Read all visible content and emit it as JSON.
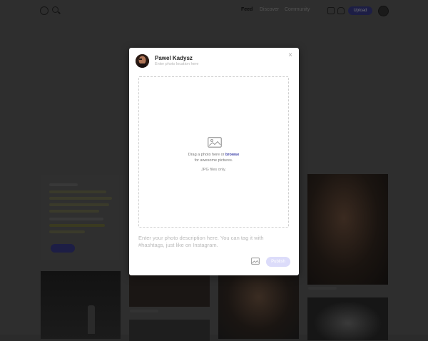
{
  "nav": {
    "items": [
      {
        "label": "Feed",
        "active": true
      },
      {
        "label": "Discover",
        "active": false
      },
      {
        "label": "Community",
        "active": false
      }
    ],
    "upload_label": "Upload"
  },
  "modal": {
    "user_name": "Pawel Kadysz",
    "location_placeholder": "Enter photo location here",
    "dropzone": {
      "line1_prefix": "Drag a photo here or ",
      "browse_label": "browse",
      "line2": "for awesome pictures.",
      "line3": "JPG files only."
    },
    "description_placeholder": "Enter your photo description here. You can tag it with #hashtags, just like on Instagram.",
    "publish_label": "Publish",
    "close_glyph": "×"
  },
  "colors": {
    "accent": "#3b3fa8",
    "publish_disabled": "#dcdcfa",
    "backdrop": "#2e2e2e"
  },
  "icons": [
    "logo-icon",
    "search-icon",
    "bell-icon",
    "inbox-icon",
    "close-icon",
    "image-placeholder-icon",
    "add-image-icon"
  ]
}
